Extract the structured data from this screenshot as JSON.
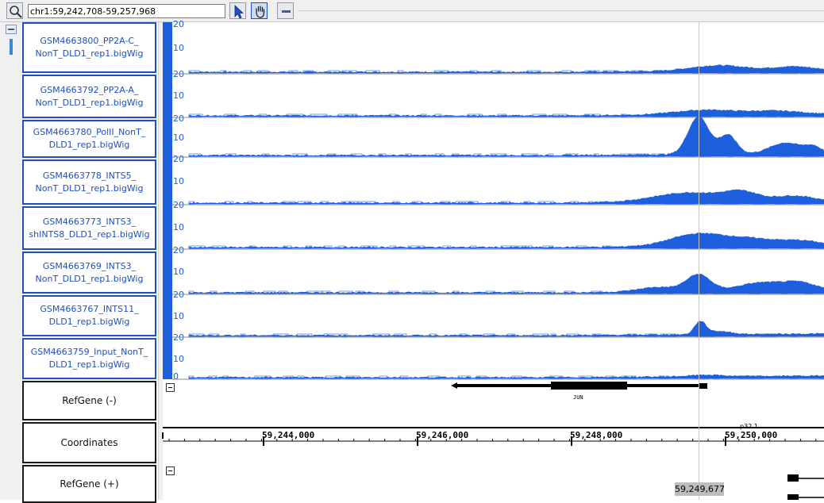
{
  "toolbar": {
    "zoom_icon": "magnifier-icon",
    "locus": "chr1:59,242,708-59,257,968",
    "pointer_icon": "arrow-cursor-icon",
    "hand_icon": "pan-hand-icon",
    "collapse_icon": "minus-icon"
  },
  "tracks": [
    {
      "name": "GSM4663800_PP2A-C_\nNonT_DLD1_rep1.bigWig",
      "labels": [
        "20",
        "10",
        "20"
      ]
    },
    {
      "name": "GSM4663792_PP2A-A_\nNonT_DLD1_rep1.bigWig",
      "labels": [
        "10",
        "20"
      ]
    },
    {
      "name": "GSM4663780_PolII_NonT_\nDLD1_rep1.bigWig",
      "labels": [
        "10",
        "20"
      ]
    },
    {
      "name": "GSM4663778_INTS5_\nNonT_DLD1_rep1.bigWig",
      "labels": [
        "10",
        "20"
      ]
    },
    {
      "name": "GSM4663773_INTS3_\nshINTS8_DLD1_rep1.bigWig",
      "labels": [
        "10",
        "20"
      ]
    },
    {
      "name": "GSM4663769_INTS3_\nNonT_DLD1_rep1.bigWig",
      "labels": [
        "10",
        "20"
      ]
    },
    {
      "name": "GSM4663767_INTS11_\nDLD1_rep1.bigWig",
      "labels": [
        "10",
        "20"
      ]
    },
    {
      "name": "GSM4663759_Input_NonT_\nDLD1_rep1.bigWig",
      "labels": [
        "10",
        "0"
      ]
    }
  ],
  "feature_tracks": {
    "refgene_minus": "RefGene (-)",
    "coordinates": "Coordinates",
    "refgene_plus": "RefGene (+)"
  },
  "gene": {
    "name": "JUN"
  },
  "cytoband": "p32.1",
  "coordinates": {
    "ticks": [
      "59,244,000",
      "59,246,000",
      "59,248,000",
      "59,250,000"
    ]
  },
  "cursor": {
    "position": "59,249,677"
  },
  "colors": {
    "signal": "#1d5fdc",
    "track_border": "#1f4fc3",
    "gene": "#000000"
  }
}
